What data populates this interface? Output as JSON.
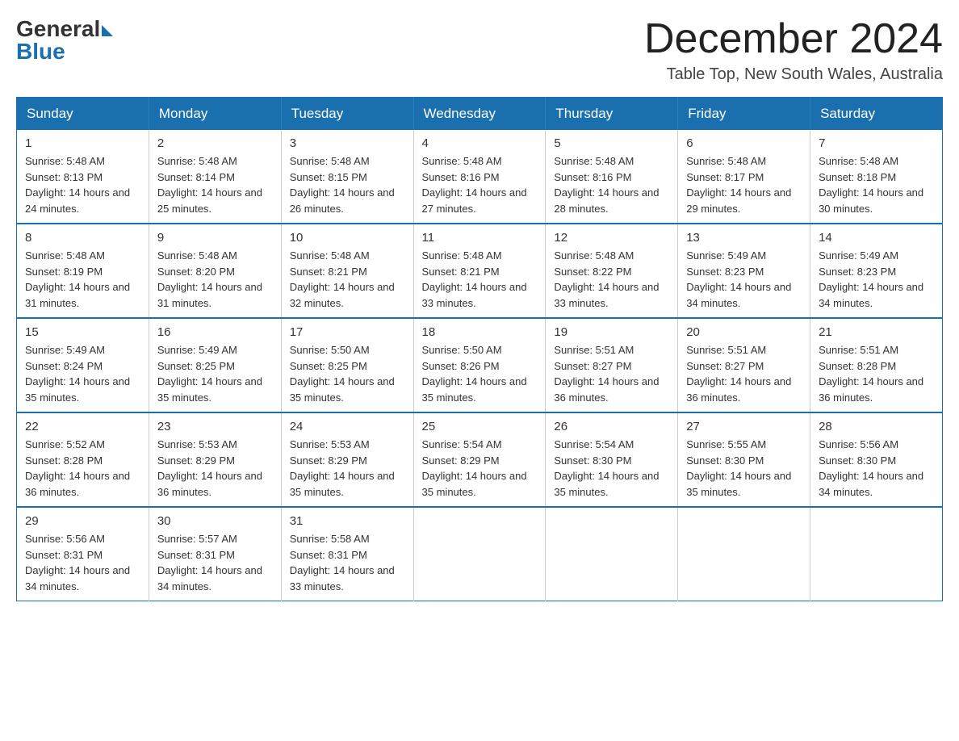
{
  "header": {
    "logo_general": "General",
    "logo_blue": "Blue",
    "title": "December 2024",
    "location": "Table Top, New South Wales, Australia"
  },
  "days_of_week": [
    "Sunday",
    "Monday",
    "Tuesday",
    "Wednesday",
    "Thursday",
    "Friday",
    "Saturday"
  ],
  "weeks": [
    [
      {
        "day": "1",
        "sunrise": "5:48 AM",
        "sunset": "8:13 PM",
        "daylight": "14 hours and 24 minutes."
      },
      {
        "day": "2",
        "sunrise": "5:48 AM",
        "sunset": "8:14 PM",
        "daylight": "14 hours and 25 minutes."
      },
      {
        "day": "3",
        "sunrise": "5:48 AM",
        "sunset": "8:15 PM",
        "daylight": "14 hours and 26 minutes."
      },
      {
        "day": "4",
        "sunrise": "5:48 AM",
        "sunset": "8:16 PM",
        "daylight": "14 hours and 27 minutes."
      },
      {
        "day": "5",
        "sunrise": "5:48 AM",
        "sunset": "8:16 PM",
        "daylight": "14 hours and 28 minutes."
      },
      {
        "day": "6",
        "sunrise": "5:48 AM",
        "sunset": "8:17 PM",
        "daylight": "14 hours and 29 minutes."
      },
      {
        "day": "7",
        "sunrise": "5:48 AM",
        "sunset": "8:18 PM",
        "daylight": "14 hours and 30 minutes."
      }
    ],
    [
      {
        "day": "8",
        "sunrise": "5:48 AM",
        "sunset": "8:19 PM",
        "daylight": "14 hours and 31 minutes."
      },
      {
        "day": "9",
        "sunrise": "5:48 AM",
        "sunset": "8:20 PM",
        "daylight": "14 hours and 31 minutes."
      },
      {
        "day": "10",
        "sunrise": "5:48 AM",
        "sunset": "8:21 PM",
        "daylight": "14 hours and 32 minutes."
      },
      {
        "day": "11",
        "sunrise": "5:48 AM",
        "sunset": "8:21 PM",
        "daylight": "14 hours and 33 minutes."
      },
      {
        "day": "12",
        "sunrise": "5:48 AM",
        "sunset": "8:22 PM",
        "daylight": "14 hours and 33 minutes."
      },
      {
        "day": "13",
        "sunrise": "5:49 AM",
        "sunset": "8:23 PM",
        "daylight": "14 hours and 34 minutes."
      },
      {
        "day": "14",
        "sunrise": "5:49 AM",
        "sunset": "8:23 PM",
        "daylight": "14 hours and 34 minutes."
      }
    ],
    [
      {
        "day": "15",
        "sunrise": "5:49 AM",
        "sunset": "8:24 PM",
        "daylight": "14 hours and 35 minutes."
      },
      {
        "day": "16",
        "sunrise": "5:49 AM",
        "sunset": "8:25 PM",
        "daylight": "14 hours and 35 minutes."
      },
      {
        "day": "17",
        "sunrise": "5:50 AM",
        "sunset": "8:25 PM",
        "daylight": "14 hours and 35 minutes."
      },
      {
        "day": "18",
        "sunrise": "5:50 AM",
        "sunset": "8:26 PM",
        "daylight": "14 hours and 35 minutes."
      },
      {
        "day": "19",
        "sunrise": "5:51 AM",
        "sunset": "8:27 PM",
        "daylight": "14 hours and 36 minutes."
      },
      {
        "day": "20",
        "sunrise": "5:51 AM",
        "sunset": "8:27 PM",
        "daylight": "14 hours and 36 minutes."
      },
      {
        "day": "21",
        "sunrise": "5:51 AM",
        "sunset": "8:28 PM",
        "daylight": "14 hours and 36 minutes."
      }
    ],
    [
      {
        "day": "22",
        "sunrise": "5:52 AM",
        "sunset": "8:28 PM",
        "daylight": "14 hours and 36 minutes."
      },
      {
        "day": "23",
        "sunrise": "5:53 AM",
        "sunset": "8:29 PM",
        "daylight": "14 hours and 36 minutes."
      },
      {
        "day": "24",
        "sunrise": "5:53 AM",
        "sunset": "8:29 PM",
        "daylight": "14 hours and 35 minutes."
      },
      {
        "day": "25",
        "sunrise": "5:54 AM",
        "sunset": "8:29 PM",
        "daylight": "14 hours and 35 minutes."
      },
      {
        "day": "26",
        "sunrise": "5:54 AM",
        "sunset": "8:30 PM",
        "daylight": "14 hours and 35 minutes."
      },
      {
        "day": "27",
        "sunrise": "5:55 AM",
        "sunset": "8:30 PM",
        "daylight": "14 hours and 35 minutes."
      },
      {
        "day": "28",
        "sunrise": "5:56 AM",
        "sunset": "8:30 PM",
        "daylight": "14 hours and 34 minutes."
      }
    ],
    [
      {
        "day": "29",
        "sunrise": "5:56 AM",
        "sunset": "8:31 PM",
        "daylight": "14 hours and 34 minutes."
      },
      {
        "day": "30",
        "sunrise": "5:57 AM",
        "sunset": "8:31 PM",
        "daylight": "14 hours and 34 minutes."
      },
      {
        "day": "31",
        "sunrise": "5:58 AM",
        "sunset": "8:31 PM",
        "daylight": "14 hours and 33 minutes."
      },
      null,
      null,
      null,
      null
    ]
  ]
}
